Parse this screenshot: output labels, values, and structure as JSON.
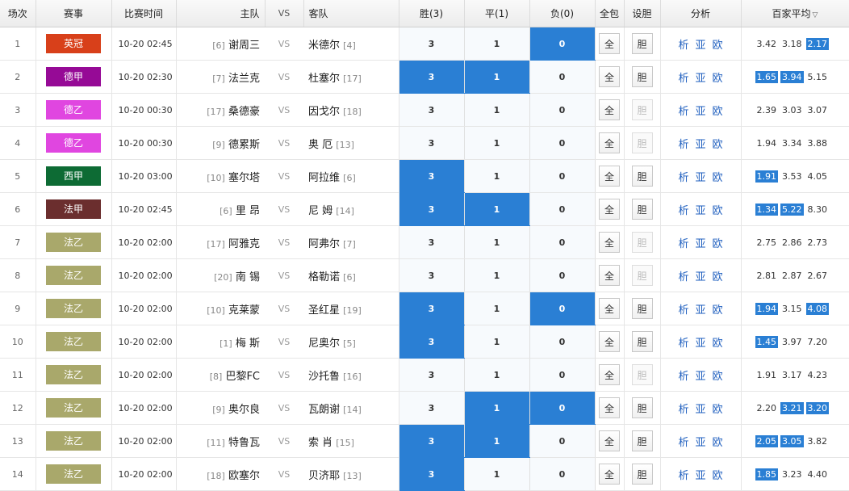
{
  "header": {
    "idx": "场次",
    "league": "赛事",
    "time": "比赛时间",
    "home": "主队",
    "vs": "VS",
    "away": "客队",
    "win": "胜(3)",
    "draw": "平(1)",
    "lose": "负(0)",
    "all": "全包",
    "banker": "设胆",
    "analysis": "分析",
    "avg": "百家平均",
    "avg_arrow": "▽"
  },
  "labels": {
    "vs": "VS",
    "all_btn": "全",
    "banker_btn": "胆",
    "ana1": "析",
    "ana2": "亚",
    "ana3": "欧"
  },
  "colors": {
    "highlight": "#2a7fd4",
    "link": "#1f5fbf"
  },
  "rows": [
    {
      "idx": "1",
      "league": "英冠",
      "lc": "#d8401a",
      "time": "10-20 02:45",
      "home_rank": "[6]",
      "home": "谢周三",
      "away": "米德尔",
      "away_rank": "[4]",
      "win": "3",
      "draw": "1",
      "lose": "0",
      "sel": [
        false,
        false,
        true
      ],
      "banker_on": true,
      "avg": [
        "3.42",
        "3.18",
        "2.17"
      ],
      "ahl": [
        false,
        false,
        true
      ]
    },
    {
      "idx": "2",
      "league": "德甲",
      "lc": "#960a96",
      "time": "10-20 02:30",
      "home_rank": "[7]",
      "home": "法兰克",
      "away": "杜塞尔",
      "away_rank": "[17]",
      "win": "3",
      "draw": "1",
      "lose": "0",
      "sel": [
        true,
        true,
        false
      ],
      "banker_on": true,
      "avg": [
        "1.65",
        "3.94",
        "5.15"
      ],
      "ahl": [
        true,
        true,
        false
      ]
    },
    {
      "idx": "3",
      "league": "德乙",
      "lc": "#e046e0",
      "time": "10-20 00:30",
      "home_rank": "[17]",
      "home": "桑德豪",
      "away": "因戈尔",
      "away_rank": "[18]",
      "win": "3",
      "draw": "1",
      "lose": "0",
      "sel": [
        false,
        false,
        false
      ],
      "banker_on": false,
      "avg": [
        "2.39",
        "3.03",
        "3.07"
      ],
      "ahl": [
        false,
        false,
        false
      ]
    },
    {
      "idx": "4",
      "league": "德乙",
      "lc": "#e046e0",
      "time": "10-20 00:30",
      "home_rank": "[9]",
      "home": "德累斯",
      "away": "奥 厄",
      "away_rank": "[13]",
      "win": "3",
      "draw": "1",
      "lose": "0",
      "sel": [
        false,
        false,
        false
      ],
      "banker_on": false,
      "avg": [
        "1.94",
        "3.34",
        "3.88"
      ],
      "ahl": [
        false,
        false,
        false
      ]
    },
    {
      "idx": "5",
      "league": "西甲",
      "lc": "#0d6b34",
      "time": "10-20 03:00",
      "home_rank": "[10]",
      "home": "塞尔塔",
      "away": "阿拉维",
      "away_rank": "[6]",
      "win": "3",
      "draw": "1",
      "lose": "0",
      "sel": [
        true,
        false,
        false
      ],
      "banker_on": true,
      "avg": [
        "1.91",
        "3.53",
        "4.05"
      ],
      "ahl": [
        true,
        false,
        false
      ]
    },
    {
      "idx": "6",
      "league": "法甲",
      "lc": "#6b2e2e",
      "time": "10-20 02:45",
      "home_rank": "[6]",
      "home": "里 昂",
      "away": "尼 姆",
      "away_rank": "[14]",
      "win": "3",
      "draw": "1",
      "lose": "0",
      "sel": [
        true,
        true,
        false
      ],
      "banker_on": true,
      "avg": [
        "1.34",
        "5.22",
        "8.30"
      ],
      "ahl": [
        true,
        true,
        false
      ]
    },
    {
      "idx": "7",
      "league": "法乙",
      "lc": "#a9a86b",
      "time": "10-20 02:00",
      "home_rank": "[17]",
      "home": "阿雅克",
      "away": "阿弗尔",
      "away_rank": "[7]",
      "win": "3",
      "draw": "1",
      "lose": "0",
      "sel": [
        false,
        false,
        false
      ],
      "banker_on": false,
      "avg": [
        "2.75",
        "2.86",
        "2.73"
      ],
      "ahl": [
        false,
        false,
        false
      ]
    },
    {
      "idx": "8",
      "league": "法乙",
      "lc": "#a9a86b",
      "time": "10-20 02:00",
      "home_rank": "[20]",
      "home": "南 锡",
      "away": "格勒诺",
      "away_rank": "[6]",
      "win": "3",
      "draw": "1",
      "lose": "0",
      "sel": [
        false,
        false,
        false
      ],
      "banker_on": false,
      "avg": [
        "2.81",
        "2.87",
        "2.67"
      ],
      "ahl": [
        false,
        false,
        false
      ]
    },
    {
      "idx": "9",
      "league": "法乙",
      "lc": "#a9a86b",
      "time": "10-20 02:00",
      "home_rank": "[10]",
      "home": "克莱蒙",
      "away": "圣红星",
      "away_rank": "[19]",
      "win": "3",
      "draw": "1",
      "lose": "0",
      "sel": [
        true,
        false,
        true
      ],
      "banker_on": true,
      "avg": [
        "1.94",
        "3.15",
        "4.08"
      ],
      "ahl": [
        true,
        false,
        true
      ]
    },
    {
      "idx": "10",
      "league": "法乙",
      "lc": "#a9a86b",
      "time": "10-20 02:00",
      "home_rank": "[1]",
      "home": "梅 斯",
      "away": "尼奥尔",
      "away_rank": "[5]",
      "win": "3",
      "draw": "1",
      "lose": "0",
      "sel": [
        true,
        false,
        false
      ],
      "banker_on": true,
      "avg": [
        "1.45",
        "3.97",
        "7.20"
      ],
      "ahl": [
        true,
        false,
        false
      ]
    },
    {
      "idx": "11",
      "league": "法乙",
      "lc": "#a9a86b",
      "time": "10-20 02:00",
      "home_rank": "[8]",
      "home": "巴黎FC",
      "away": "沙托鲁",
      "away_rank": "[16]",
      "win": "3",
      "draw": "1",
      "lose": "0",
      "sel": [
        false,
        false,
        false
      ],
      "banker_on": false,
      "avg": [
        "1.91",
        "3.17",
        "4.23"
      ],
      "ahl": [
        false,
        false,
        false
      ]
    },
    {
      "idx": "12",
      "league": "法乙",
      "lc": "#a9a86b",
      "time": "10-20 02:00",
      "home_rank": "[9]",
      "home": "奥尔良",
      "away": "瓦朗谢",
      "away_rank": "[14]",
      "win": "3",
      "draw": "1",
      "lose": "0",
      "sel": [
        false,
        true,
        true
      ],
      "banker_on": true,
      "avg": [
        "2.20",
        "3.21",
        "3.20"
      ],
      "ahl": [
        false,
        true,
        true
      ]
    },
    {
      "idx": "13",
      "league": "法乙",
      "lc": "#a9a86b",
      "time": "10-20 02:00",
      "home_rank": "[11]",
      "home": "特鲁瓦",
      "away": "索 肖",
      "away_rank": "[15]",
      "win": "3",
      "draw": "1",
      "lose": "0",
      "sel": [
        true,
        true,
        false
      ],
      "banker_on": true,
      "avg": [
        "2.05",
        "3.05",
        "3.82"
      ],
      "ahl": [
        true,
        true,
        false
      ]
    },
    {
      "idx": "14",
      "league": "法乙",
      "lc": "#a9a86b",
      "time": "10-20 02:00",
      "home_rank": "[18]",
      "home": "欧塞尔",
      "away": "贝济耶",
      "away_rank": "[13]",
      "win": "3",
      "draw": "1",
      "lose": "0",
      "sel": [
        true,
        false,
        false
      ],
      "banker_on": true,
      "avg": [
        "1.85",
        "3.23",
        "4.40"
      ],
      "ahl": [
        true,
        false,
        false
      ]
    }
  ]
}
